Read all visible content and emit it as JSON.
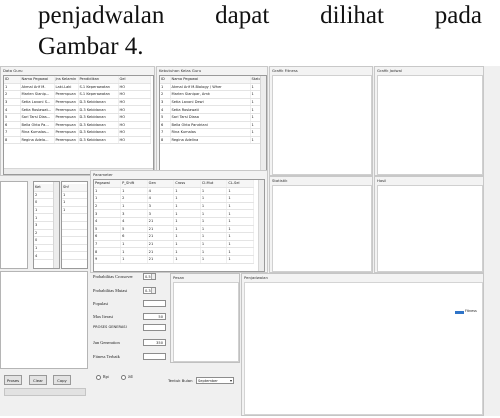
{
  "document": {
    "words_line1": [
      "penjadwalan",
      "dapat",
      "dilihat",
      "pada"
    ],
    "line2": "Gambar 4."
  },
  "app": {
    "panel_guru_title": "Data Guru",
    "panel_kelas_title": "Kebutuhan Kelas Guru",
    "panel_grafik1_title": "Grafik Fitness",
    "panel_grafik2_title": "Grafik Jadwal",
    "panel_stat_title": "Statistik",
    "panel_hasil_title": "Hasil",
    "panel_parameter_title": "Parameter",
    "panel_pesan_title": "Pesan",
    "panel_penjadwalan_title": "Penjadwalan",
    "guru_table": {
      "headers": [
        "ID",
        "Nama Pegawai",
        "Jns Kelamin",
        "Pendidikan",
        "Gel"
      ],
      "rows": [
        [
          "1",
          "Akmal Arif M.",
          "Laki-Laki",
          "S.1 Keperawatan",
          "HO"
        ],
        [
          "2",
          "Marlen Sianip...",
          "Perempuan",
          "S.1 Keperawatan",
          "HO"
        ],
        [
          "3",
          "Setia Lavoni S...",
          "Perempuan",
          "D.3 Kebidanan",
          "HO"
        ],
        [
          "4",
          "Setia Roslawat...",
          "Perempuan",
          "D.3 Kebidanan",
          "HO"
        ],
        [
          "5",
          "Sari Tarsi Dias...",
          "Perempuan",
          "D.3 Kebidanan",
          "HO"
        ],
        [
          "6",
          "Bella Okta Pa...",
          "Perempuan",
          "D.3 Kebidanan",
          "HO"
        ],
        [
          "7",
          "Rina Kumalas...",
          "Perempuan",
          "D.3 Kebidanan",
          "HO"
        ],
        [
          "8",
          "Regina Adela...",
          "Perempuan",
          "D.3 Kebidanan",
          "HO"
        ]
      ]
    },
    "kelas_table": {
      "headers": [
        "ID",
        "Nama Pegawai",
        "Status"
      ],
      "rows": [
        [
          "1",
          "Akmal Arif M.Biology / Wher",
          "1"
        ],
        [
          "2",
          "Marlen Sianipar, Amk",
          "1"
        ],
        [
          "3",
          "Setia Lavoni Dewi",
          "1"
        ],
        [
          "4",
          "Setia Roslawati",
          "1"
        ],
        [
          "5",
          "Sari Tarsi Diasa",
          "1"
        ],
        [
          "6",
          "Bella Okta Pandriani",
          "1"
        ],
        [
          "7",
          "Rina Kumalas",
          "1"
        ],
        [
          "8",
          "Regina Adelina",
          "1"
        ]
      ]
    },
    "small_table1": {
      "headers": [
        "Ket"
      ],
      "rows": [
        [
          "2"
        ],
        [
          "0"
        ],
        [
          "1"
        ],
        [
          "1"
        ],
        [
          "3"
        ],
        [
          "2"
        ],
        [
          "0"
        ],
        [
          "1"
        ],
        [
          "4"
        ]
      ]
    },
    "small_table2": {
      "headers": [
        "Shf"
      ],
      "rows": [
        [
          "1"
        ],
        [
          "1"
        ],
        [
          "1"
        ],
        [
          ""
        ],
        [
          ""
        ],
        [
          ""
        ],
        [
          ""
        ],
        [
          ""
        ],
        [
          ""
        ]
      ]
    },
    "param_table": {
      "headers": [
        "Pegawai",
        "P_Shift",
        "Gen",
        "Cross",
        "Cl.Mut",
        "CL.Sel"
      ],
      "rows": [
        [
          "1",
          "1",
          "4",
          "1",
          "1",
          "1"
        ],
        [
          "1",
          "2",
          "4",
          "1",
          "1",
          "1"
        ],
        [
          "2",
          "1",
          "3",
          "1",
          "1",
          "1"
        ],
        [
          "3",
          "3",
          "3",
          "1",
          "1",
          "1"
        ],
        [
          "4",
          "4",
          "21",
          "1",
          "1",
          "1"
        ],
        [
          "5",
          "5",
          "21",
          "1",
          "1",
          "1"
        ],
        [
          "6",
          "6",
          "21",
          "1",
          "1",
          "1"
        ],
        [
          "7",
          "1",
          "21",
          "1",
          "1",
          "1"
        ],
        [
          "8",
          "1",
          "21",
          "1",
          "1",
          "1"
        ],
        [
          "9",
          "1",
          "21",
          "1",
          "1",
          "1"
        ]
      ]
    },
    "form": {
      "crossover_label": "Probabilitas Crossover",
      "crossover_value": "0.5",
      "mutasi_label": "Probabilitas Mutasi",
      "mutasi_value": "0.3",
      "populasi_label": "Populasi",
      "iterasi_label": "Max Iterasi",
      "iterasi_value": "50",
      "proses_label": "PROSES GENERASI",
      "generation_label": "Jun Generation",
      "generation_value": "350",
      "fitness_label": "Fitness Terbaik"
    },
    "buttons": {
      "proses": "Proses",
      "clear": "Clear",
      "copy": "Copy"
    },
    "radio": {
      "opt1": "Rpt",
      "opt2": "Jdl"
    },
    "bulan_label": "Tentuk Bulan",
    "bulan_value": "September",
    "legend_label": "Fitness"
  },
  "colors": {
    "legend_blue": "#2f74c8"
  }
}
